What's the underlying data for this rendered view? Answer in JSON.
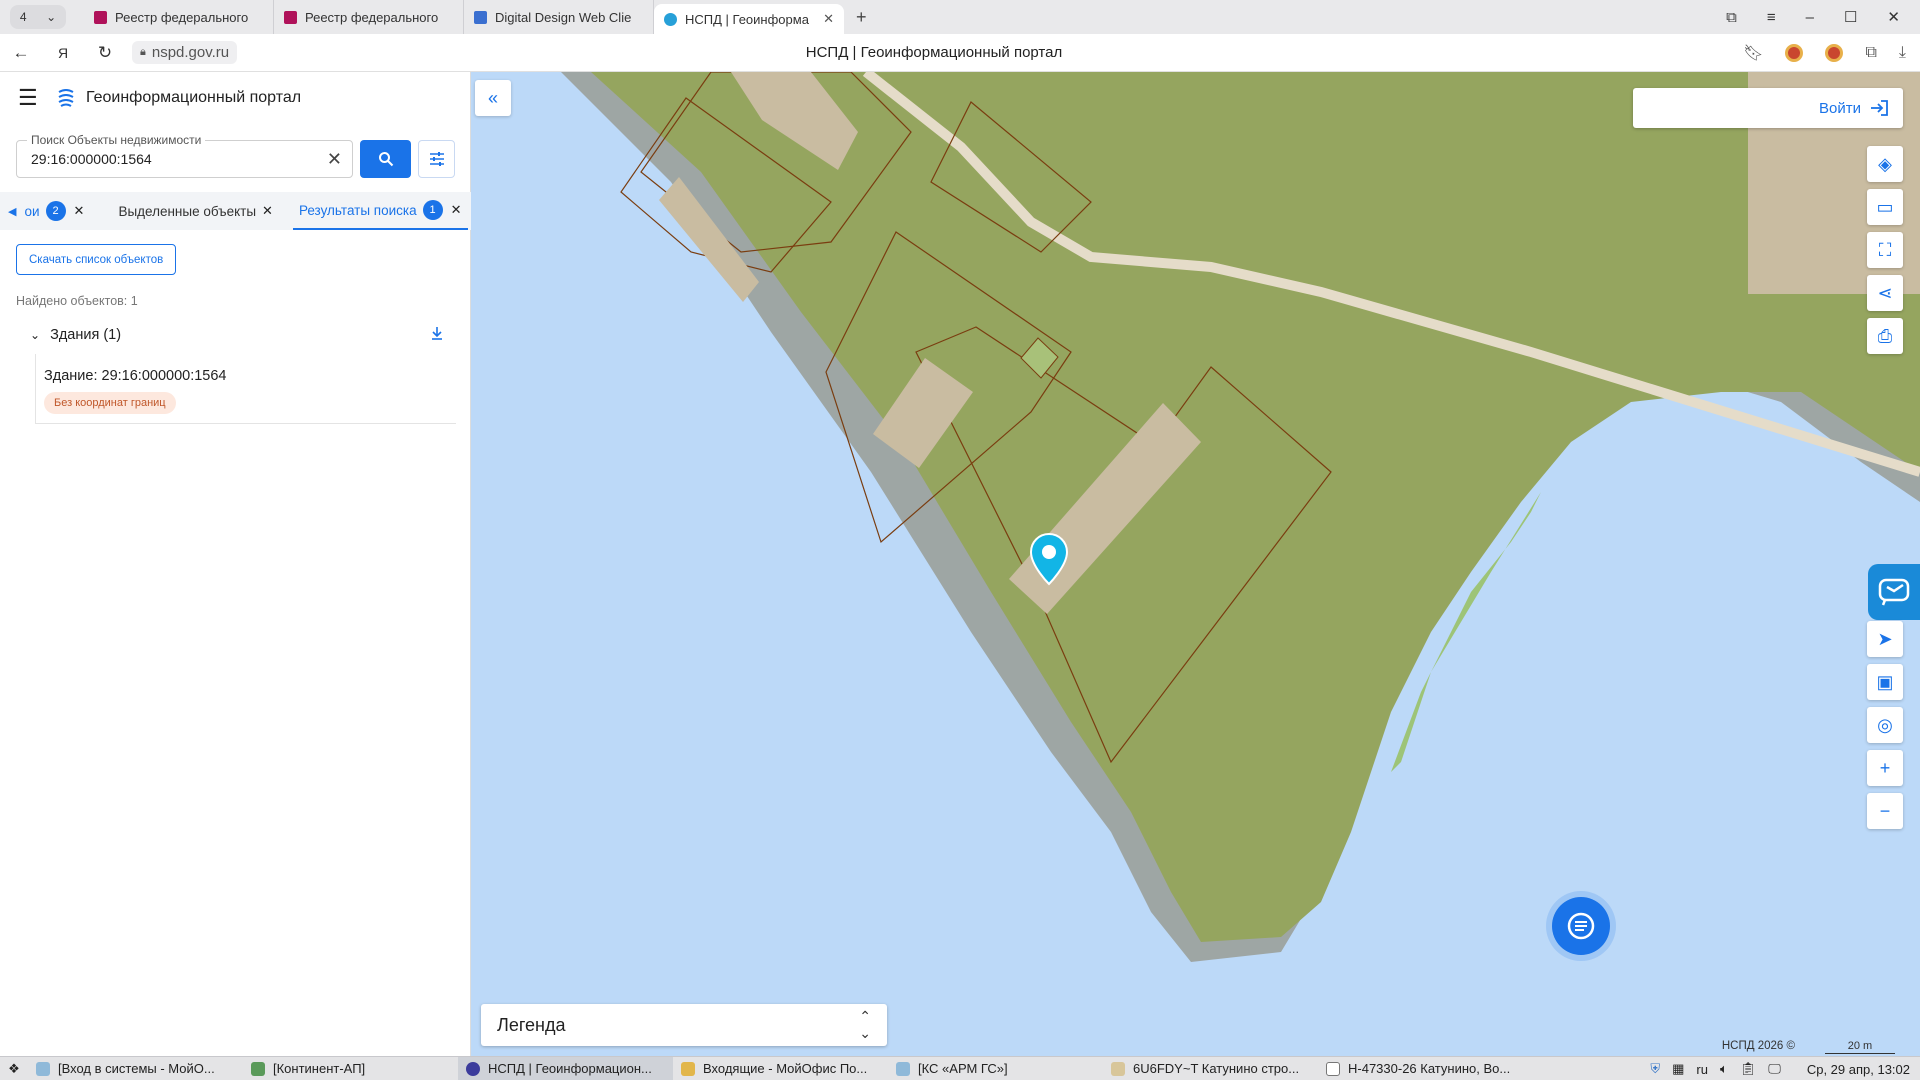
{
  "browser": {
    "tab_count": "4",
    "tabs": [
      {
        "title": "Реестр федерального",
        "active": false
      },
      {
        "title": "Реестр федерального",
        "active": false
      },
      {
        "title": "Digital Design Web Clie",
        "active": false
      },
      {
        "title": "НСПД | Геоинформа",
        "active": true
      }
    ],
    "url": "nspd.gov.ru",
    "page_title": "НСПД | Геоинформационный портал"
  },
  "panel": {
    "portal_title": "Геоинформационный портал",
    "search": {
      "label": "Поиск Объекты недвижимости",
      "value": "29:16:000000:1564"
    },
    "tabs": [
      {
        "label": "ои",
        "badge": "2"
      },
      {
        "label": "Выделенные объекты",
        "badge": ""
      },
      {
        "label": "Результаты поиска",
        "badge": "1"
      }
    ],
    "download_list_label": "Скачать список объектов",
    "found_text": "Найдено объектов: 1",
    "group_label": "Здания (1)",
    "result": {
      "title": "Здание: 29:16:000000:1564",
      "badge": "Без координат границ"
    }
  },
  "map": {
    "login_label": "Войти",
    "legend_label": "Легенда",
    "copyright": "НСПД 2026 ©",
    "scale_label": "20 m",
    "colors": {
      "water": "#bcd9f8",
      "land": "#95a55f",
      "shore": "#9ea6a4",
      "building": "#c9bca1",
      "parcel_border": "#7a3d10",
      "accent": "#1a73e8"
    }
  },
  "taskbar": {
    "items": [
      {
        "label": "[Вход в системы - МойО..."
      },
      {
        "label": "[Континент-АП]"
      },
      {
        "label": "НСПД | Геоинформацион..."
      },
      {
        "label": "Входящие - МойОфис По..."
      },
      {
        "label": "[КС «АРМ ГС»]"
      },
      {
        "label": "6U6FDY~T Катунино стро..."
      },
      {
        "label": "Н-47330-26 Катунино, Во..."
      }
    ],
    "lang": "ru",
    "clock": "Ср, 29 апр, 13:02"
  }
}
